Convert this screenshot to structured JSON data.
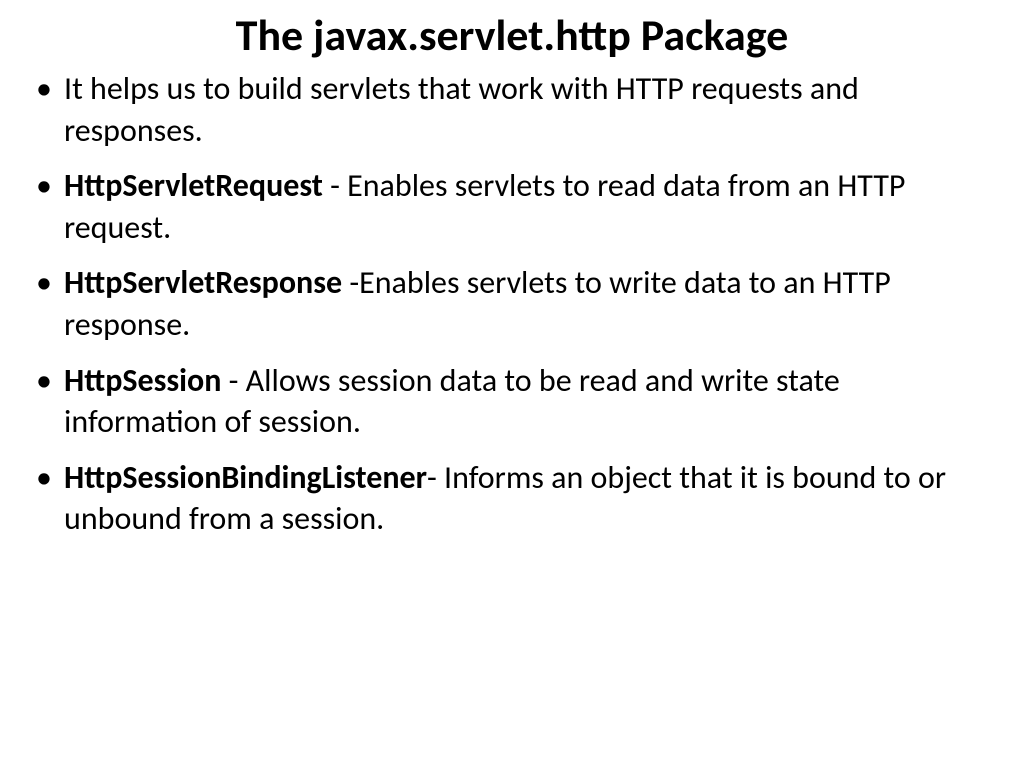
{
  "title": "The javax.servlet.http Package",
  "bullets": [
    {
      "bold": "",
      "text": "It helps us to build servlets that work with HTTP requests and responses."
    },
    {
      "bold": "HttpServletRequest",
      "text": " - Enables servlets to read data from an HTTP request."
    },
    {
      "bold": "HttpServletResponse",
      "text": " -Enables servlets to write data to an HTTP response."
    },
    {
      "bold": "HttpSession",
      "text": " -  Allows session data to be read and write state information of session."
    },
    {
      "bold": "HttpSessionBindingListener",
      "text": "-     Informs an object that it is bound to or unbound from a session."
    }
  ]
}
